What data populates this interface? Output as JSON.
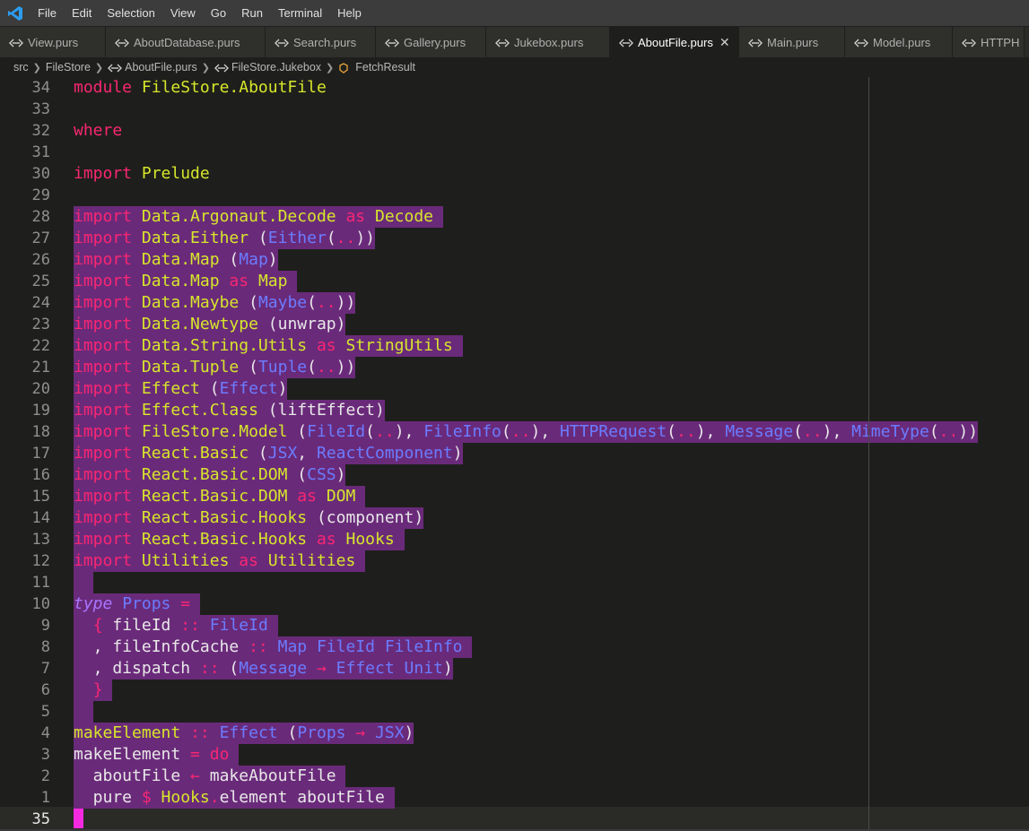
{
  "menubar": {
    "items": [
      "File",
      "Edit",
      "Selection",
      "View",
      "Go",
      "Run",
      "Terminal",
      "Help"
    ]
  },
  "tabs": [
    {
      "label": "View.purs",
      "active": false
    },
    {
      "label": "AboutDatabase.purs",
      "active": false
    },
    {
      "label": "Search.purs",
      "active": false
    },
    {
      "label": "Gallery.purs",
      "active": false
    },
    {
      "label": "Jukebox.purs",
      "active": false
    },
    {
      "label": "AboutFile.purs",
      "active": true
    },
    {
      "label": "Main.purs",
      "active": false
    },
    {
      "label": "Model.purs",
      "active": false
    },
    {
      "label": "HTTPH",
      "active": false
    }
  ],
  "breadcrumb": {
    "items": [
      "src",
      "FileStore",
      "AboutFile.purs",
      "FileStore.Jukebox",
      "FetchResult"
    ]
  },
  "editor": {
    "lines": [
      {
        "n": "34",
        "selected": false,
        "tokens": [
          [
            "k",
            "module"
          ],
          [
            "p",
            " "
          ],
          [
            "m",
            "FileStore.AboutFile"
          ]
        ]
      },
      {
        "n": "33",
        "selected": false,
        "tokens": []
      },
      {
        "n": "32",
        "selected": false,
        "tokens": [
          [
            "k",
            "where"
          ]
        ]
      },
      {
        "n": "31",
        "selected": false,
        "tokens": []
      },
      {
        "n": "30",
        "selected": false,
        "tokens": [
          [
            "k",
            "import"
          ],
          [
            "p",
            " "
          ],
          [
            "m",
            "Prelude"
          ]
        ]
      },
      {
        "n": "29",
        "selected": false,
        "tokens": []
      },
      {
        "n": "28",
        "selected": true,
        "tokens": [
          [
            "k",
            "import"
          ],
          [
            "p",
            " "
          ],
          [
            "m",
            "Data.Argonaut.Decode"
          ],
          [
            "p",
            " "
          ],
          [
            "k",
            "as"
          ],
          [
            "p",
            " "
          ],
          [
            "m",
            "Decode"
          ],
          [
            "p",
            " "
          ]
        ]
      },
      {
        "n": "27",
        "selected": true,
        "tokens": [
          [
            "k",
            "import"
          ],
          [
            "p",
            " "
          ],
          [
            "m",
            "Data.Either"
          ],
          [
            "p",
            " ("
          ],
          [
            "t",
            "Either"
          ],
          [
            "p",
            "("
          ],
          [
            "dim",
            ".."
          ],
          [
            "p",
            "))"
          ]
        ]
      },
      {
        "n": "26",
        "selected": true,
        "tokens": [
          [
            "k",
            "import"
          ],
          [
            "p",
            " "
          ],
          [
            "m",
            "Data.Map"
          ],
          [
            "p",
            " ("
          ],
          [
            "t",
            "Map"
          ],
          [
            "p",
            ")"
          ]
        ]
      },
      {
        "n": "25",
        "selected": true,
        "tokens": [
          [
            "k",
            "import"
          ],
          [
            "p",
            " "
          ],
          [
            "m",
            "Data.Map"
          ],
          [
            "p",
            " "
          ],
          [
            "k",
            "as"
          ],
          [
            "p",
            " "
          ],
          [
            "m",
            "Map"
          ],
          [
            "p",
            " "
          ]
        ]
      },
      {
        "n": "24",
        "selected": true,
        "tokens": [
          [
            "k",
            "import"
          ],
          [
            "p",
            " "
          ],
          [
            "m",
            "Data.Maybe"
          ],
          [
            "p",
            " ("
          ],
          [
            "t",
            "Maybe"
          ],
          [
            "p",
            "("
          ],
          [
            "dim",
            ".."
          ],
          [
            "p",
            "))"
          ]
        ]
      },
      {
        "n": "23",
        "selected": true,
        "tokens": [
          [
            "k",
            "import"
          ],
          [
            "p",
            " "
          ],
          [
            "m",
            "Data.Newtype"
          ],
          [
            "p",
            " ("
          ],
          [
            "p",
            "unwrap"
          ],
          [
            "p",
            ")"
          ]
        ]
      },
      {
        "n": "22",
        "selected": true,
        "tokens": [
          [
            "k",
            "import"
          ],
          [
            "p",
            " "
          ],
          [
            "m",
            "Data.String.Utils"
          ],
          [
            "p",
            " "
          ],
          [
            "k",
            "as"
          ],
          [
            "p",
            " "
          ],
          [
            "m",
            "StringUtils"
          ],
          [
            "p",
            " "
          ]
        ]
      },
      {
        "n": "21",
        "selected": true,
        "tokens": [
          [
            "k",
            "import"
          ],
          [
            "p",
            " "
          ],
          [
            "m",
            "Data.Tuple"
          ],
          [
            "p",
            " ("
          ],
          [
            "t",
            "Tuple"
          ],
          [
            "p",
            "("
          ],
          [
            "dim",
            ".."
          ],
          [
            "p",
            "))"
          ]
        ]
      },
      {
        "n": "20",
        "selected": true,
        "tokens": [
          [
            "k",
            "import"
          ],
          [
            "p",
            " "
          ],
          [
            "m",
            "Effect"
          ],
          [
            "p",
            " ("
          ],
          [
            "t",
            "Effect"
          ],
          [
            "p",
            ")"
          ]
        ]
      },
      {
        "n": "19",
        "selected": true,
        "tokens": [
          [
            "k",
            "import"
          ],
          [
            "p",
            " "
          ],
          [
            "m",
            "Effect.Class"
          ],
          [
            "p",
            " ("
          ],
          [
            "p",
            "liftEffect"
          ],
          [
            "p",
            ")"
          ]
        ]
      },
      {
        "n": "18",
        "selected": true,
        "tokens": [
          [
            "k",
            "import"
          ],
          [
            "p",
            " "
          ],
          [
            "m",
            "FileStore.Model"
          ],
          [
            "p",
            " ("
          ],
          [
            "t",
            "FileId"
          ],
          [
            "p",
            "("
          ],
          [
            "dim",
            ".."
          ],
          [
            "p",
            "), "
          ],
          [
            "t",
            "FileInfo"
          ],
          [
            "p",
            "("
          ],
          [
            "dim",
            ".."
          ],
          [
            "p",
            "), "
          ],
          [
            "t",
            "HTTPRequest"
          ],
          [
            "p",
            "("
          ],
          [
            "dim",
            ".."
          ],
          [
            "p",
            "), "
          ],
          [
            "t",
            "Message"
          ],
          [
            "p",
            "("
          ],
          [
            "dim",
            ".."
          ],
          [
            "p",
            "), "
          ],
          [
            "t",
            "MimeType"
          ],
          [
            "p",
            "("
          ],
          [
            "dim",
            ".."
          ],
          [
            "p",
            "))"
          ]
        ]
      },
      {
        "n": "17",
        "selected": true,
        "tokens": [
          [
            "k",
            "import"
          ],
          [
            "p",
            " "
          ],
          [
            "m",
            "React.Basic"
          ],
          [
            "p",
            " ("
          ],
          [
            "t",
            "JSX"
          ],
          [
            "p",
            ", "
          ],
          [
            "t",
            "ReactComponent"
          ],
          [
            "p",
            ")"
          ]
        ]
      },
      {
        "n": "16",
        "selected": true,
        "tokens": [
          [
            "k",
            "import"
          ],
          [
            "p",
            " "
          ],
          [
            "m",
            "React.Basic.DOM"
          ],
          [
            "p",
            " ("
          ],
          [
            "t",
            "CSS"
          ],
          [
            "p",
            ")"
          ]
        ]
      },
      {
        "n": "15",
        "selected": true,
        "tokens": [
          [
            "k",
            "import"
          ],
          [
            "p",
            " "
          ],
          [
            "m",
            "React.Basic.DOM"
          ],
          [
            "p",
            " "
          ],
          [
            "k",
            "as"
          ],
          [
            "p",
            " "
          ],
          [
            "m",
            "DOM"
          ],
          [
            "p",
            " "
          ]
        ]
      },
      {
        "n": "14",
        "selected": true,
        "tokens": [
          [
            "k",
            "import"
          ],
          [
            "p",
            " "
          ],
          [
            "m",
            "React.Basic.Hooks"
          ],
          [
            "p",
            " ("
          ],
          [
            "p",
            "component"
          ],
          [
            "p",
            ")"
          ]
        ]
      },
      {
        "n": "13",
        "selected": true,
        "tokens": [
          [
            "k",
            "import"
          ],
          [
            "p",
            " "
          ],
          [
            "m",
            "React.Basic.Hooks"
          ],
          [
            "p",
            " "
          ],
          [
            "k",
            "as"
          ],
          [
            "p",
            " "
          ],
          [
            "m",
            "Hooks"
          ],
          [
            "p",
            " "
          ]
        ]
      },
      {
        "n": "12",
        "selected": true,
        "tokens": [
          [
            "k",
            "import"
          ],
          [
            "p",
            " "
          ],
          [
            "m",
            "Utilities"
          ],
          [
            "p",
            " "
          ],
          [
            "k",
            "as"
          ],
          [
            "p",
            " "
          ],
          [
            "m",
            "Utilities"
          ],
          [
            "p",
            " "
          ]
        ]
      },
      {
        "n": "11",
        "selected": true,
        "tokens": [
          [
            "p",
            "  "
          ]
        ]
      },
      {
        "n": "10",
        "selected": true,
        "tokens": [
          [
            "ty",
            "type"
          ],
          [
            "p",
            " "
          ],
          [
            "t",
            "Props"
          ],
          [
            "p",
            " "
          ],
          [
            "k",
            "="
          ],
          [
            "p",
            " "
          ]
        ]
      },
      {
        "n": "9",
        "selected": true,
        "tokens": [
          [
            "p",
            "  "
          ],
          [
            "k",
            "{"
          ],
          [
            "p",
            " fileId "
          ],
          [
            "k",
            "::"
          ],
          [
            "p",
            " "
          ],
          [
            "t",
            "FileId"
          ],
          [
            "p",
            " "
          ]
        ]
      },
      {
        "n": "8",
        "selected": true,
        "tokens": [
          [
            "p",
            "  , fileInfoCache "
          ],
          [
            "k",
            "::"
          ],
          [
            "p",
            " "
          ],
          [
            "t",
            "Map FileId FileInfo"
          ],
          [
            "p",
            " "
          ]
        ]
      },
      {
        "n": "7",
        "selected": true,
        "tokens": [
          [
            "p",
            "  , dispatch "
          ],
          [
            "k",
            "::"
          ],
          [
            "p",
            " ("
          ],
          [
            "t",
            "Message"
          ],
          [
            "p",
            " "
          ],
          [
            "k",
            "→"
          ],
          [
            "p",
            " "
          ],
          [
            "t",
            "Effect Unit"
          ],
          [
            "p",
            ")"
          ]
        ]
      },
      {
        "n": "6",
        "selected": true,
        "tokens": [
          [
            "p",
            "  "
          ],
          [
            "k",
            "}"
          ],
          [
            "p",
            " "
          ]
        ]
      },
      {
        "n": "5",
        "selected": true,
        "tokens": [
          [
            "p",
            "  "
          ]
        ]
      },
      {
        "n": "4",
        "selected": true,
        "tokens": [
          [
            "f",
            "makeElement"
          ],
          [
            "p",
            " "
          ],
          [
            "k",
            "::"
          ],
          [
            "p",
            " "
          ],
          [
            "t",
            "Effect"
          ],
          [
            "p",
            " ("
          ],
          [
            "t",
            "Props"
          ],
          [
            "p",
            " "
          ],
          [
            "k",
            "→"
          ],
          [
            "p",
            " "
          ],
          [
            "t",
            "JSX"
          ],
          [
            "p",
            ")"
          ]
        ]
      },
      {
        "n": "3",
        "selected": true,
        "tokens": [
          [
            "p",
            "makeElement "
          ],
          [
            "k",
            "="
          ],
          [
            "p",
            " "
          ],
          [
            "k",
            "do"
          ],
          [
            "p",
            " "
          ]
        ]
      },
      {
        "n": "2",
        "selected": true,
        "tokens": [
          [
            "p",
            "  aboutFile "
          ],
          [
            "k",
            "←"
          ],
          [
            "p",
            " makeAboutFile "
          ]
        ]
      },
      {
        "n": "1",
        "selected": true,
        "tokens": [
          [
            "p",
            "  pure "
          ],
          [
            "k",
            "$"
          ],
          [
            "p",
            " "
          ],
          [
            "m",
            "Hooks"
          ],
          [
            "k",
            "."
          ],
          [
            "p",
            "element aboutFile "
          ]
        ]
      },
      {
        "n": "35",
        "selected": false,
        "current": true,
        "tokens": []
      }
    ]
  }
}
